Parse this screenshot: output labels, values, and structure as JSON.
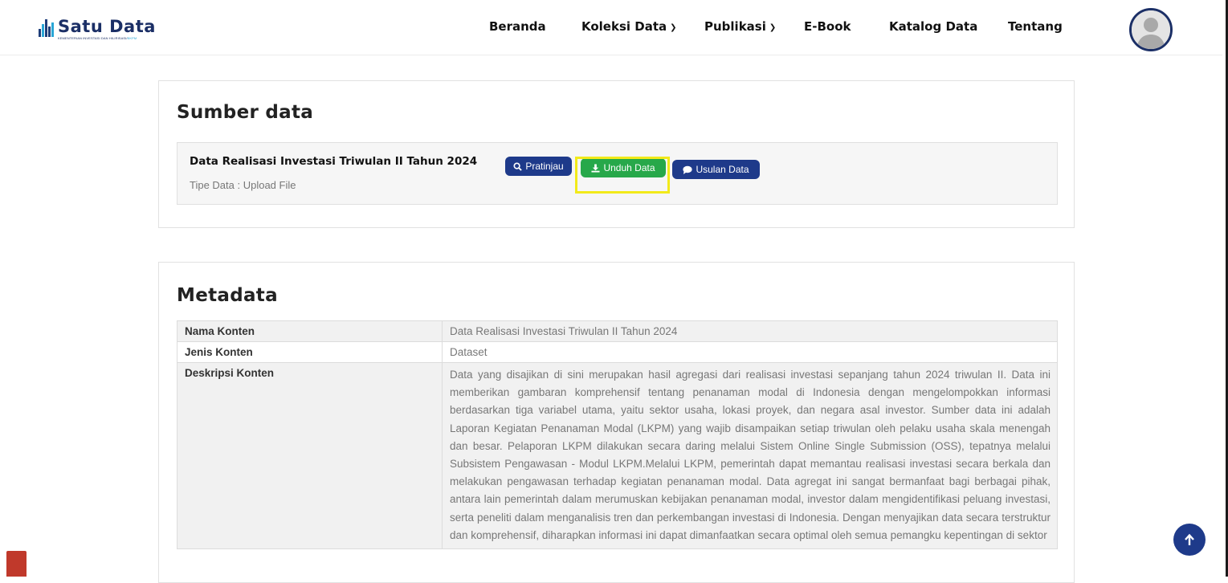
{
  "brand": {
    "title": "Satu Data",
    "subtitle_main": "KEMENTERIAN INVESTASI DAN HILIRISASI/",
    "subtitle_accent": "BKPM"
  },
  "nav": {
    "home": "Beranda",
    "collection": "Koleksi Data",
    "publication": "Publikasi",
    "ebook": "E-Book",
    "catalog": "Katalog Data",
    "about": "Tentang"
  },
  "source_section": {
    "title": "Sumber data",
    "item_name": "Data Realisasi Investasi Triwulan II Tahun 2024",
    "item_type": "Tipe Data : Upload File",
    "preview_label": "Pratinjau",
    "download_label": "Unduh Data",
    "proposal_label": "Usulan Data"
  },
  "metadata_section": {
    "title": "Metadata",
    "rows": [
      {
        "key": "Nama Konten",
        "value": "Data Realisasi Investasi Triwulan II Tahun 2024"
      },
      {
        "key": "Jenis Konten",
        "value": "Dataset"
      },
      {
        "key": "Deskripsi Konten",
        "value": "Data yang disajikan di sini merupakan hasil agregasi dari realisasi investasi sepanjang tahun 2024 triwulan II. Data ini memberikan gambaran komprehensif tentang penanaman modal di Indonesia dengan mengelompokkan informasi berdasarkan tiga variabel utama, yaitu sektor usaha, lokasi proyek, dan negara asal investor. Sumber data ini adalah Laporan Kegiatan Penanaman Modal (LKPM) yang wajib disampaikan setiap triwulan oleh pelaku usaha skala menengah dan besar. Pelaporan LKPM dilakukan secara daring melalui Sistem Online Single Submission (OSS), tepatnya melalui Subsistem Pengawasan - Modul LKPM.Melalui LKPM, pemerintah dapat memantau realisasi investasi secara berkala dan melakukan pengawasan terhadap kegiatan penanaman modal. Data agregat ini sangat bermanfaat bagi berbagai pihak, antara lain pemerintah dalam merumuskan kebijakan penanaman modal, investor dalam mengidentifikasi peluang investasi, serta peneliti dalam menganalisis tren dan perkembangan investasi di Indonesia. Dengan menyajikan data secara terstruktur dan komprehensif, diharapkan informasi ini dapat dimanfaatkan secara optimal oleh semua pemangku kepentingan di sektor"
      }
    ]
  },
  "colors": {
    "navy": "#1e3a8a",
    "green": "#27a84a",
    "highlight": "#f2ea1a"
  },
  "icons": {
    "preview": "search-icon",
    "download": "download-icon",
    "proposal": "chat-icon",
    "scroll_top": "arrow-up-icon",
    "avatar": "user-avatar-icon"
  }
}
